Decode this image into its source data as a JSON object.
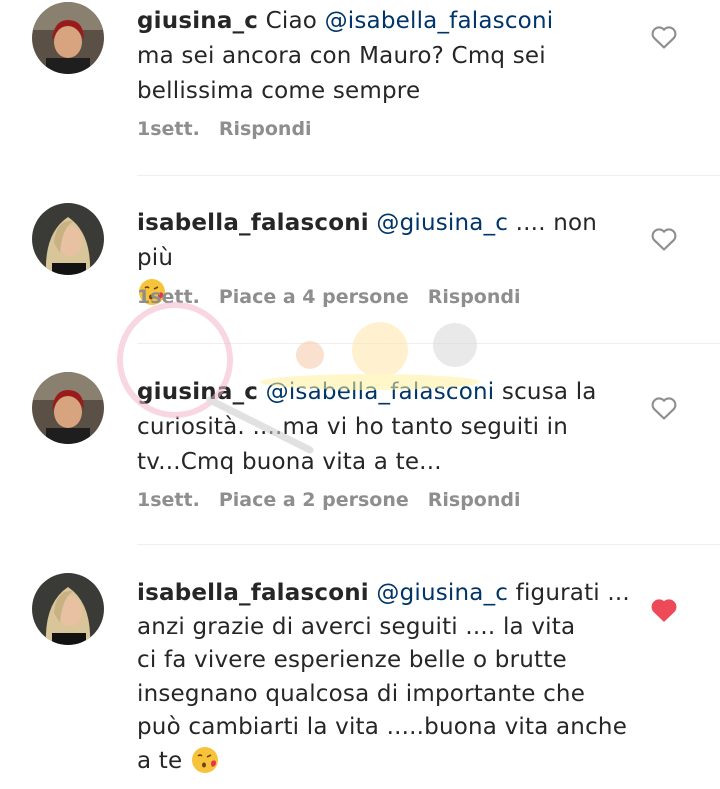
{
  "comments": [
    {
      "username": "giusina_c",
      "mention": "@isabella_falasconi",
      "text_before": "Ciao ",
      "text_after_line1": "",
      "line2": "ma sei ancora con Mauro?  Cmq sei",
      "line3": "bellissima come sempre",
      "time": "1sett.",
      "reply": "Rispondi",
      "liked": false
    },
    {
      "username": "isabella_falasconi",
      "mention": "@giusina_c",
      "text_after": ".... non più",
      "time": "1sett.",
      "likes": "Piace a 4 persone",
      "reply": "Rispondi",
      "liked": false
    },
    {
      "username": "giusina_c",
      "mention": "@isabella_falasconi",
      "text_after": "scusa la",
      "line2": "curiosità. ....ma vi ho tanto seguiti in",
      "line3": "tv...Cmq buona vita a te...",
      "time": "1sett.",
      "likes": "Piace a 2 persone",
      "reply": "Rispondi",
      "liked": false
    },
    {
      "username": "isabella_falasconi",
      "mention": "@giusina_c",
      "text_after": "figurati ...",
      "line2": "anzi grazie di averci seguiti .... la vita",
      "line3": "ci fa vivere esperienze belle o brutte",
      "line4": "insegnano qualcosa di importante che",
      "line5": "può cambiarti la vita .....buona vita anche",
      "line6": "a te",
      "liked": true
    }
  ],
  "colors": {
    "heart_liked": "#ed4956",
    "heart_outline": "#8e8e8e",
    "mention": "#003569",
    "meta": "#8e8e8e"
  },
  "icons": [
    "heart-outline-icon",
    "heart-filled-icon",
    "kiss-emoji-icon"
  ]
}
